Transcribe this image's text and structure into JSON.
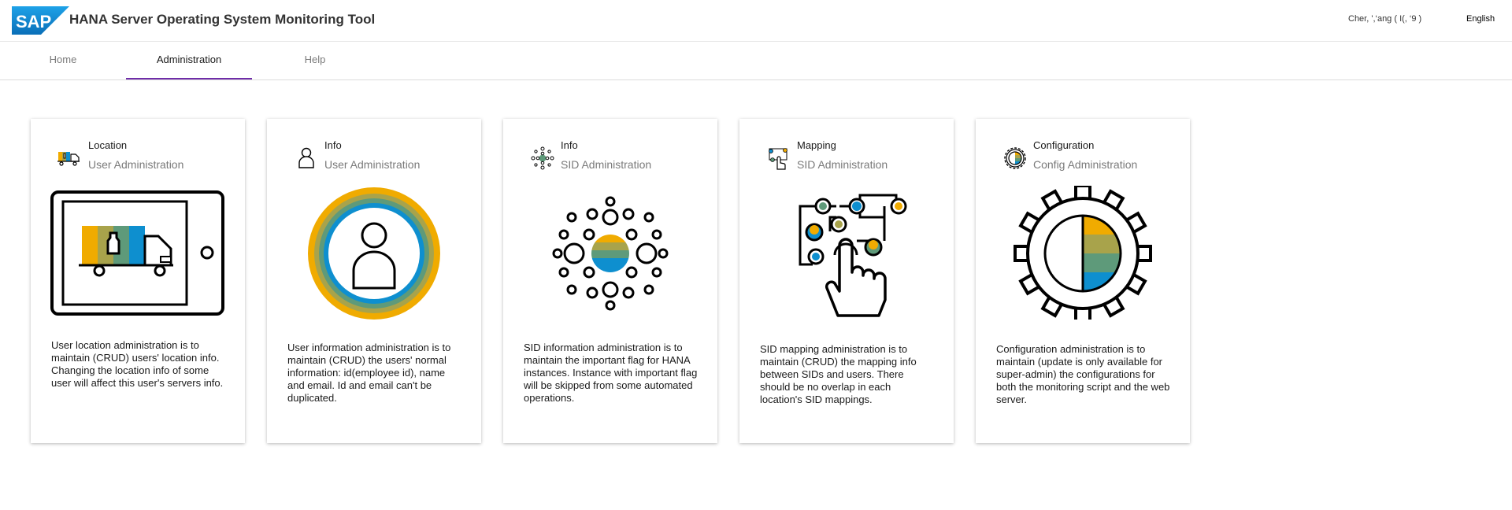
{
  "header": {
    "logo_text": "SAP",
    "title": "HANA Server Operating System Monitoring Tool",
    "user": "Cher, ',‘ang ( I(, ‘9 )",
    "language": "English"
  },
  "tabs": [
    {
      "label": "Home",
      "active": false
    },
    {
      "label": "Administration",
      "active": true
    },
    {
      "label": "Help",
      "active": false
    }
  ],
  "cards": [
    {
      "title": "Location",
      "subtitle": "User Administration",
      "icon": "truck-icon",
      "illustration": "tablet-truck-illustration",
      "description": "User location administration is to maintain (CRUD) users' location info. Changing the location info of some user will affect this user's servers info."
    },
    {
      "title": "Info",
      "subtitle": "User Administration",
      "icon": "person-icon",
      "illustration": "person-circle-illustration",
      "description": "User information administration is to maintain (CRUD) the users' normal information: id(employee id), name and email. Id and email can't be duplicated."
    },
    {
      "title": "Info",
      "subtitle": "SID Administration",
      "icon": "dots-cluster-icon",
      "illustration": "dots-cluster-illustration",
      "description": "SID information administration is to maintain the important flag for HANA instances. Instance with important flag will be skipped from some automated operations."
    },
    {
      "title": "Mapping",
      "subtitle": "SID Administration",
      "icon": "mapping-touch-icon",
      "illustration": "mapping-touch-illustration",
      "description": "SID mapping administration is to maintain (CRUD) the mapping info between SIDs and users. There should be no overlap in each location's SID mappings."
    },
    {
      "title": "Configuration",
      "subtitle": "Config Administration",
      "icon": "gear-icon",
      "illustration": "gear-illustration",
      "description": "Configuration administration is to maintain (update is only available for super-admin) the configurations for both the monitoring script and the web server."
    }
  ],
  "colors": {
    "sap_blue": "#0a8fd6",
    "tab_active_underline": "#6f2da8",
    "orange": "#f0ab00",
    "olive": "#a8a34b",
    "green": "#5e9a7a",
    "blue": "#0e8fcf"
  }
}
